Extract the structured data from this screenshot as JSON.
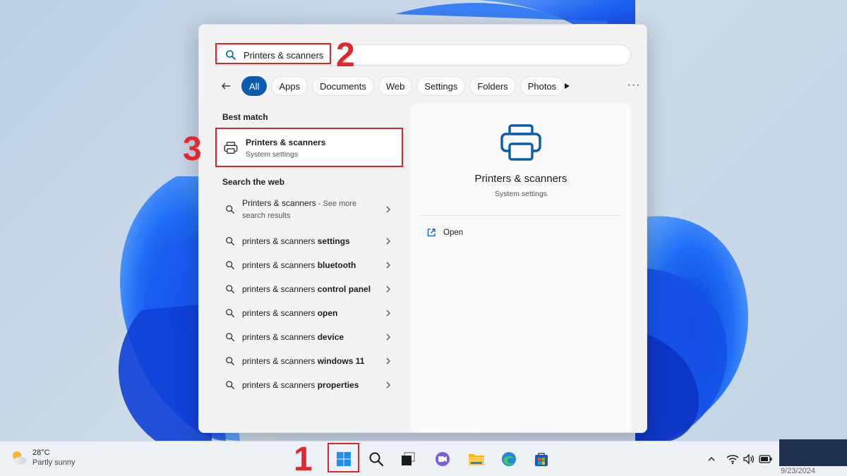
{
  "search": {
    "query": "Printers & scanners"
  },
  "filters": {
    "items": [
      "All",
      "Apps",
      "Documents",
      "Web",
      "Settings",
      "Folders",
      "Photos"
    ],
    "more_label": "···"
  },
  "best_match": {
    "heading": "Best match",
    "title": "Printers & scanners",
    "subtitle": "System settings"
  },
  "web": {
    "heading": "Search the web",
    "first_item": {
      "label": "Printers & scanners",
      "suffix": " - See more",
      "suffix2": "search results"
    },
    "items": [
      {
        "prefix": "printers & scanners ",
        "bold": "settings"
      },
      {
        "prefix": "printers & scanners ",
        "bold": "bluetooth"
      },
      {
        "prefix": "printers & scanners ",
        "bold": "control panel"
      },
      {
        "prefix": "printers & scanners ",
        "bold": "open"
      },
      {
        "prefix": "printers & scanners ",
        "bold": "device"
      },
      {
        "prefix": "printers & scanners ",
        "bold": "windows 11"
      },
      {
        "prefix": "printers & scanners ",
        "bold": "properties"
      }
    ]
  },
  "preview": {
    "title": "Printers & scanners",
    "subtitle": "System settings",
    "open_label": "Open"
  },
  "annotations": {
    "step1": "1",
    "step2": "2",
    "step3": "3"
  },
  "taskbar": {
    "weather_temp": "28°C",
    "weather_cond": "Partly sunny",
    "date_partial": "9/23/2024"
  },
  "colors": {
    "accent": "#0b5cad",
    "annotation": "#d9262b",
    "panel_bg": "#f3f3f3"
  },
  "icons": {
    "search": "search-icon",
    "back": "back-arrow-icon",
    "play": "play-icon",
    "printer": "printer-icon",
    "chevron": "chevron-right-icon",
    "open": "open-external-icon"
  }
}
